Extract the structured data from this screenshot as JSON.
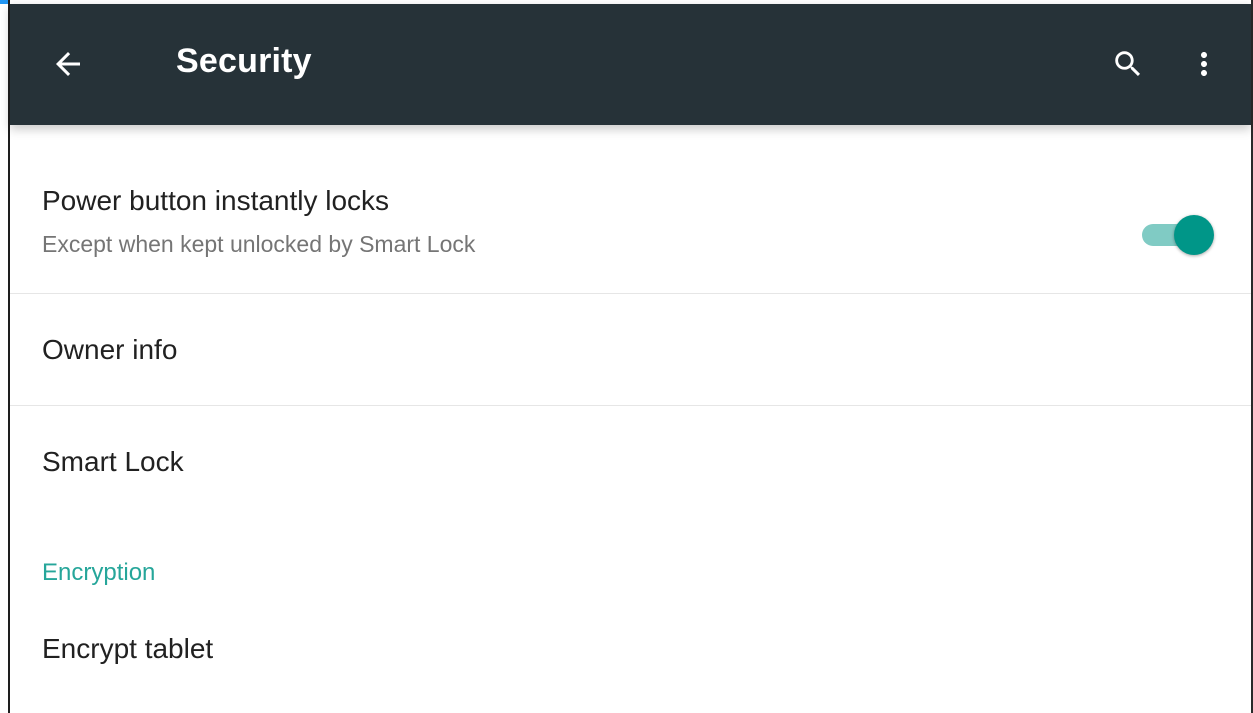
{
  "app_bar": {
    "title": "Security",
    "background": "#263238",
    "icons": {
      "back": "arrow-back-icon",
      "search": "search-icon",
      "more": "more-vert-icon"
    }
  },
  "settings": {
    "power_button": {
      "label": "Power button instantly locks",
      "summary": "Except when kept unlocked by Smart Lock",
      "enabled": true
    },
    "owner_info": {
      "label": "Owner info"
    },
    "smart_lock": {
      "label": "Smart Lock"
    },
    "encryption_section": {
      "header": "Encryption"
    },
    "encrypt_tablet": {
      "label": "Encrypt tablet"
    }
  },
  "colors": {
    "accent": "#26a69a",
    "toggle_thumb": "#009688",
    "toggle_track": "#80cbc4",
    "primary_text": "#212121",
    "secondary_text": "#757575"
  }
}
